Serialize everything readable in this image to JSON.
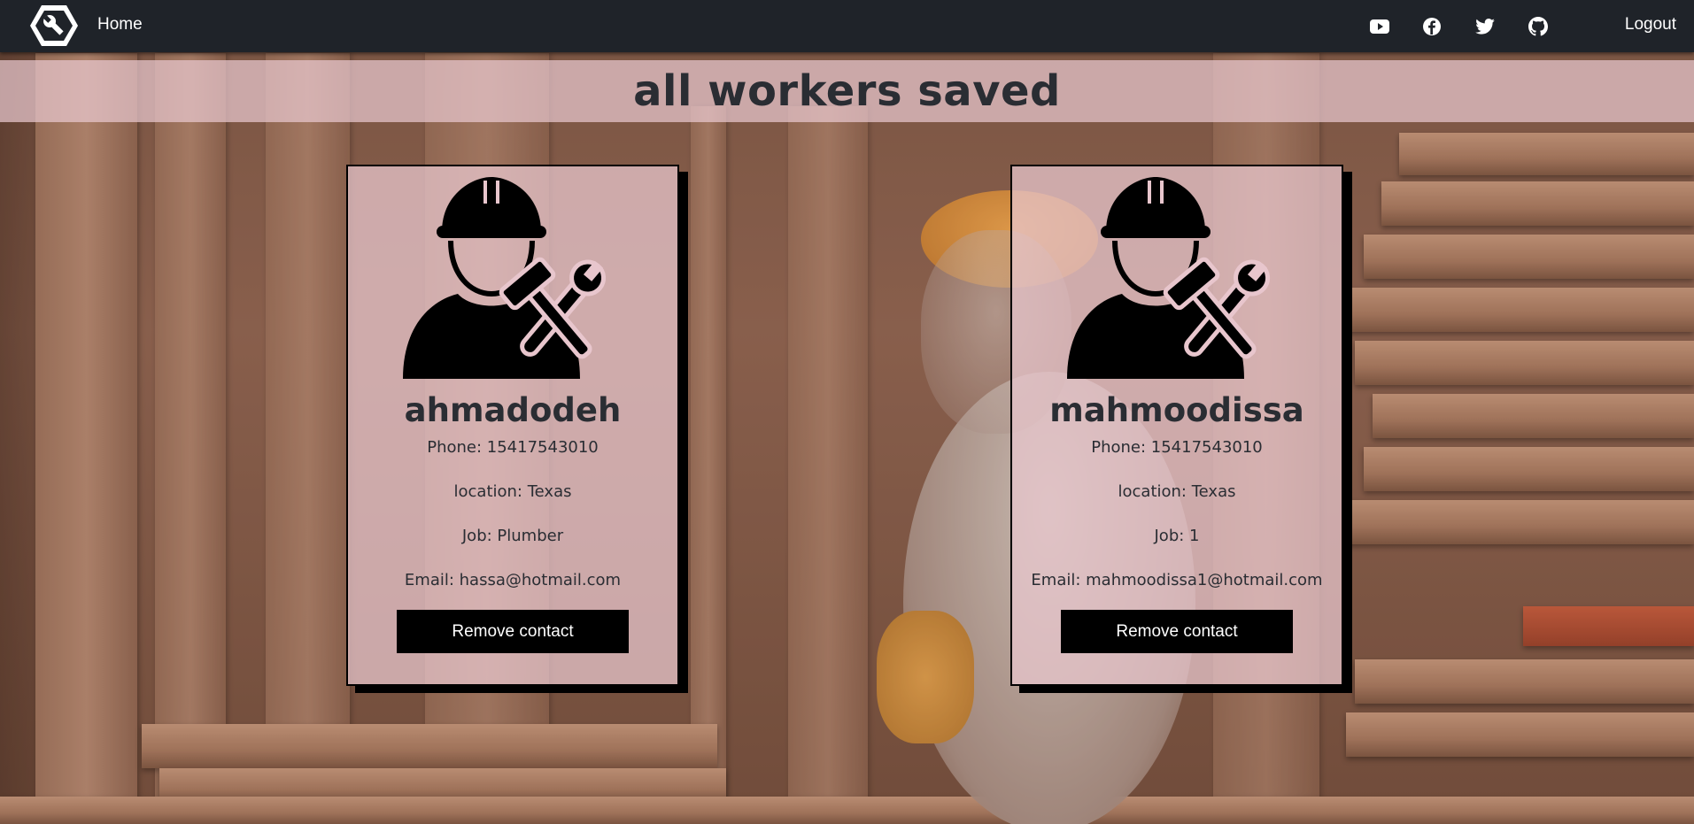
{
  "navbar": {
    "home_label": "Home",
    "logout_label": "Logout",
    "social_icons": [
      "youtube-icon",
      "facebook-icon",
      "twitter-icon",
      "github-icon"
    ],
    "background_color": "#1f2329"
  },
  "page": {
    "title": "all workers saved"
  },
  "workers": [
    {
      "name": "ahmadodeh",
      "phone": "Phone: 15417543010",
      "location": "location: Texas",
      "job": "Job: Plumber",
      "email": "Email: hassa@hotmail.com",
      "remove_label": "Remove contact"
    },
    {
      "name": "mahmoodissa",
      "phone": "Phone: 15417543010",
      "location": "location: Texas",
      "job": "Job: 1",
      "email": "Email: mahmoodissa1@hotmail.com",
      "remove_label": "Remove contact"
    }
  ],
  "colors": {
    "card_background": "#e8c6cd",
    "button_background": "#000000",
    "text": "#2a2d33"
  }
}
